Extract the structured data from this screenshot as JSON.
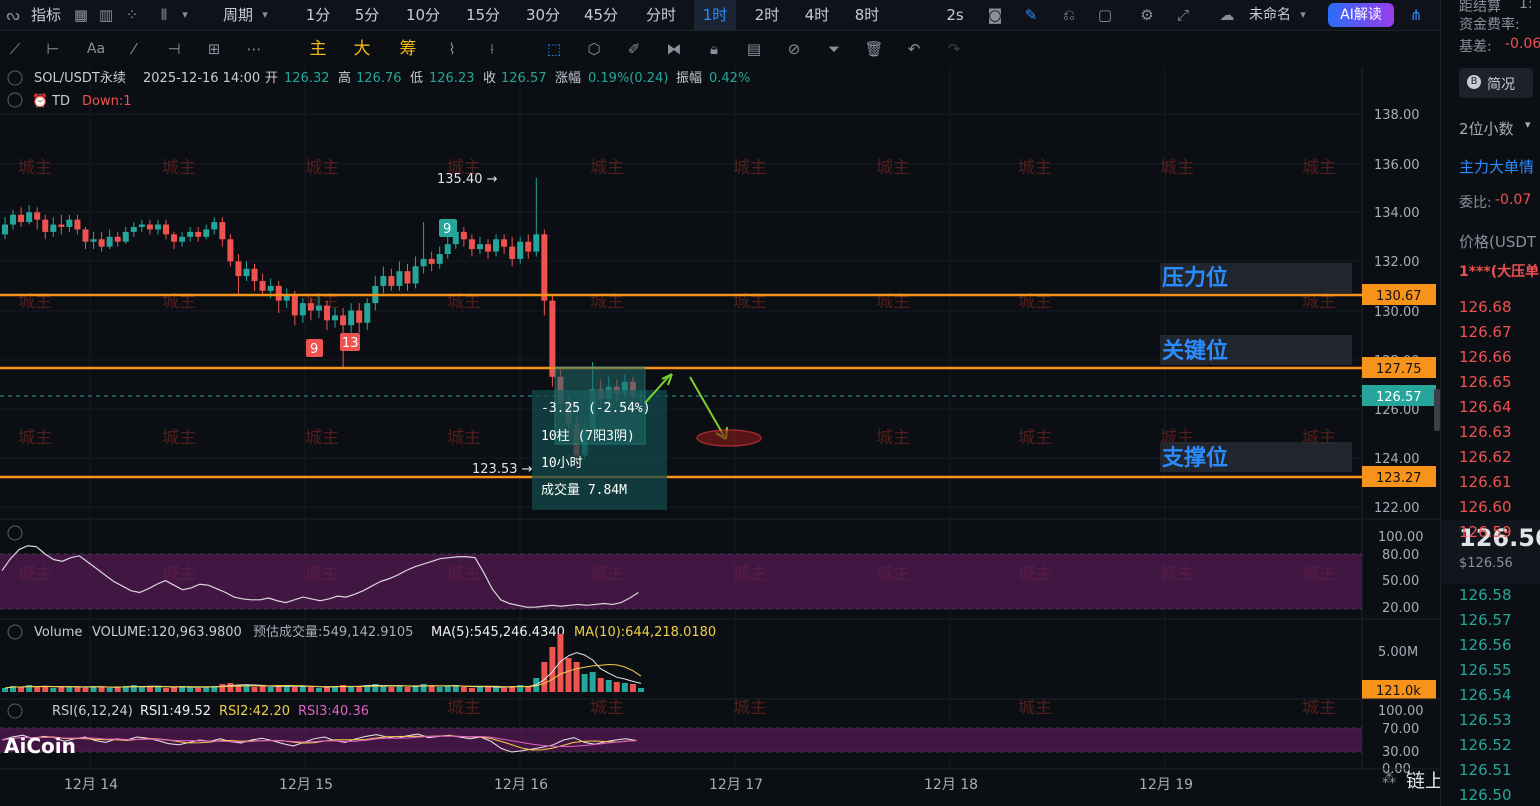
{
  "topbar": {
    "indicators_label": "指标",
    "period_label": "周期",
    "timeframes": [
      "1分",
      "5分",
      "10分",
      "15分",
      "30分",
      "45分",
      "分时",
      "1时",
      "2时",
      "4时",
      "8时"
    ],
    "active_timeframe": "1时",
    "speed_label": "2s",
    "layout_name": "未命名",
    "ai_button": "AI解读"
  },
  "toolbar": {
    "labels": [
      "主",
      "大",
      "筹"
    ]
  },
  "symbol_info": {
    "pair": "SOL/USDT永续",
    "datetime": "2025-12-16 14:00",
    "open_label": "开",
    "open": "126.32",
    "high_label": "高",
    "high": "126.76",
    "low_label": "低",
    "low": "126.23",
    "close_label": "收",
    "close": "126.57",
    "change_label": "涨幅",
    "change": "0.19%(0.24)",
    "amp_label": "振幅",
    "amp": "0.42%"
  },
  "td_indicator": {
    "name": "TD",
    "value": "Down:1"
  },
  "price_axis": [
    "138.00",
    "136.00",
    "134.00",
    "132.00",
    "130.00",
    "128.00",
    "126.00",
    "124.00",
    "122.00"
  ],
  "levels": {
    "resistance": {
      "label": "压力位",
      "price": "130.67"
    },
    "key": {
      "label": "关键位",
      "price": "127.75"
    },
    "support": {
      "label": "支撑位",
      "price": "123.27"
    },
    "current": "126.57"
  },
  "annotations": {
    "high_mark": "135.40 →",
    "low_mark": "123.53 →",
    "td9_a": "9",
    "td9_b": "9",
    "td13": "13",
    "measure_change": "-3.25 (-2.54%)",
    "measure_bars": "10柱 (7阳3阴)",
    "measure_time": "10小时",
    "measure_volume": "成交量 7.84M"
  },
  "osc_axis": [
    "100.00",
    "80.00",
    "50.00",
    "20.00"
  ],
  "volume": {
    "name": "Volume",
    "volume_value": "VOLUME:120,963.9800",
    "est_value": "预估成交量:549,142.9105",
    "ma5": "MA(5):545,246.4340",
    "ma10": "MA(10):644,218.0180",
    "axis_top": "5.00M",
    "axis_current": "121.0k"
  },
  "rsi": {
    "name": "RSI(6,12,24)",
    "rsi1": "RSI1:49.52",
    "rsi2": "RSI2:42.20",
    "rsi3": "RSI3:40.36",
    "axis": [
      "100.00",
      "70.00",
      "30.00",
      "0.00"
    ]
  },
  "x_axis": [
    "12月 14",
    "12月 15",
    "12月 16",
    "12月 17",
    "12月 18",
    "12月 19"
  ],
  "logo": "AiCoin",
  "watermark": "城主",
  "footer_brand": "链上城主",
  "sidebar": {
    "dist_label": "距结算",
    "dist_value": "1:",
    "funding_label": "资金费率:",
    "basis_label": "基差:",
    "basis_value": "-0.06",
    "simple_button": "简况",
    "decimals": "2位小数",
    "big_orders": "主力大单情",
    "ratio_label": "委比:",
    "ratio_value": "-0.07",
    "price_header": "价格(USDT",
    "big_ask": "1***(大压单",
    "asks": [
      "126.68",
      "126.67",
      "126.66",
      "126.65",
      "126.64",
      "126.63",
      "126.62",
      "126.61",
      "126.60",
      "126.59"
    ],
    "last_price": "126.56",
    "last_price_sub": "$126.56",
    "bids": [
      "126.58",
      "126.57",
      "126.56",
      "126.55",
      "126.54",
      "126.53",
      "126.52",
      "126.51",
      "126.50"
    ]
  },
  "colors": {
    "up": "#26a69a",
    "down": "#ef5350",
    "level": "#f7931a",
    "accent": "#2a8cff",
    "osc_band": "#5a1a57"
  }
}
